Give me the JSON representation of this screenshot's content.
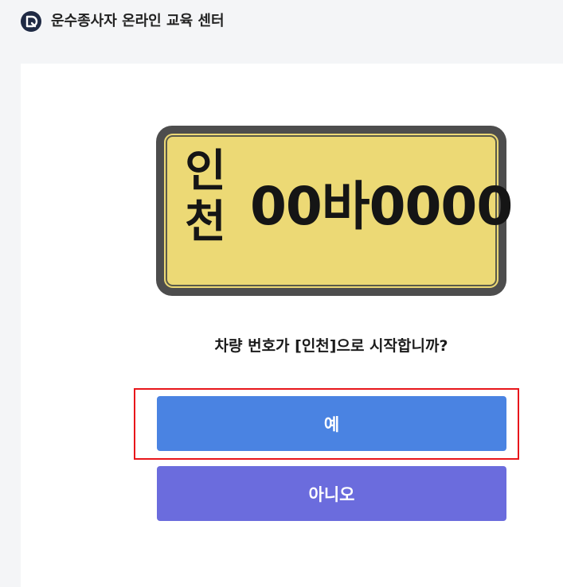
{
  "header": {
    "title": "운수종사자 온라인 교육 센터",
    "logo_icon": "app-logo-icon"
  },
  "plate": {
    "region_line1": "인",
    "region_line2": "천",
    "number": "00바0000",
    "colors": {
      "frame": "#4d4d4d",
      "background": "#ecd975",
      "text": "#151515"
    }
  },
  "question": {
    "text": "차량 번호가 [인천]으로 시작합니까?"
  },
  "buttons": {
    "yes_label": "예",
    "no_label": "아니오",
    "colors": {
      "yes": "#4a83e2",
      "no": "#6b6cdd",
      "highlight_border": "#e8161b"
    }
  }
}
